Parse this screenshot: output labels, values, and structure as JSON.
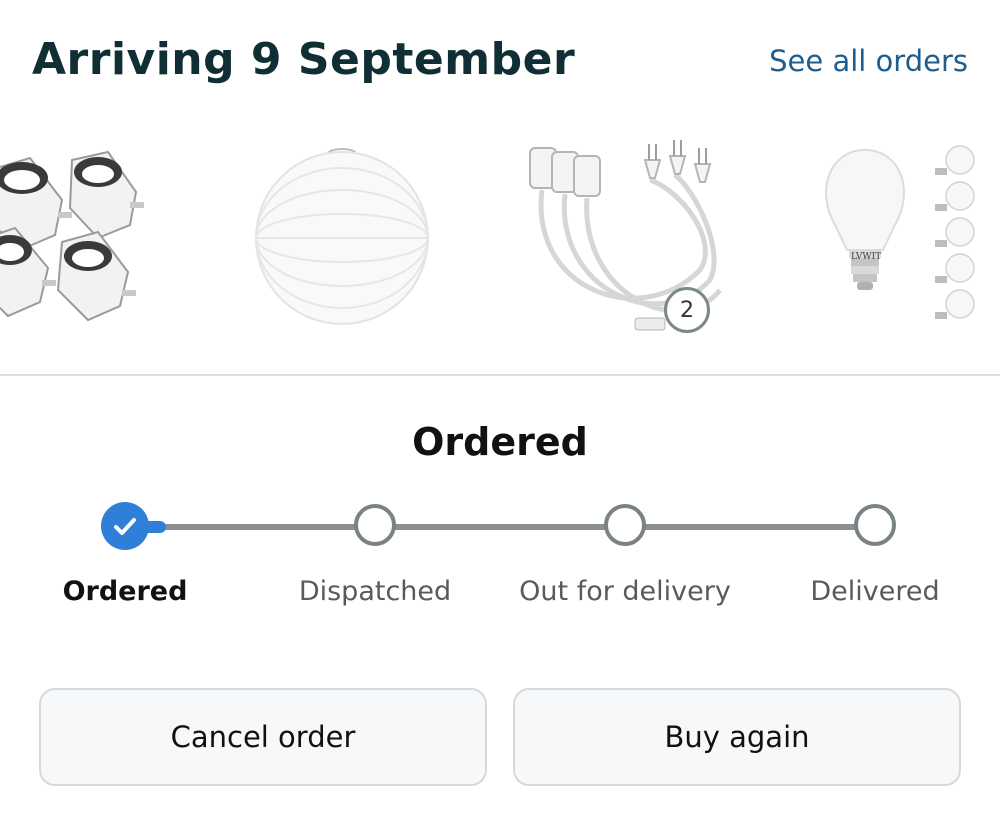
{
  "header": {
    "title": "Arriving 9 September",
    "see_all_label": "See all orders"
  },
  "products": [
    {
      "name": "smart-plug-4-pack",
      "icon": "smart-plug-icon"
    },
    {
      "name": "paper-lantern",
      "icon": "paper-lantern-icon"
    },
    {
      "name": "pendant-cord-set",
      "icon": "lamp-cord-icon",
      "quantity": "2"
    },
    {
      "name": "led-bulb-pack",
      "icon": "light-bulb-icon",
      "brand_text": "LVWIT"
    }
  ],
  "tracker": {
    "heading": "Ordered",
    "current_step": 0,
    "steps": [
      {
        "label": "Ordered"
      },
      {
        "label": "Dispatched"
      },
      {
        "label": "Out for delivery"
      },
      {
        "label": "Delivered"
      }
    ]
  },
  "actions": {
    "cancel_label": "Cancel order",
    "buy_again_label": "Buy again"
  },
  "colors": {
    "accent": "#2f7fd8",
    "title": "#0f2f35",
    "link": "#1f5e8c"
  }
}
